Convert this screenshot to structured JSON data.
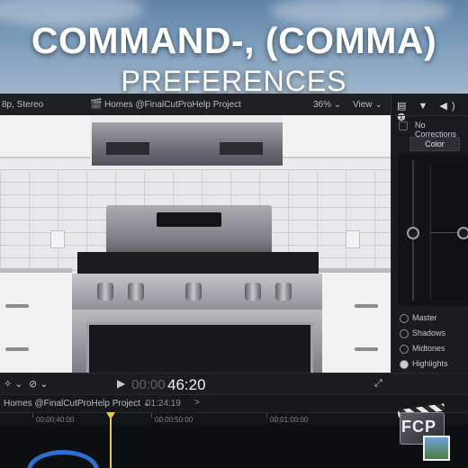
{
  "banner": {
    "title": "COMMAND-, (COMMA)",
    "subtitle": "PREFERENCES"
  },
  "viewer_bar": {
    "format": "8p, Stereo",
    "project": "Homes @FinalCutProHelp Project",
    "zoom": "36% ⌄",
    "view": "View ⌄"
  },
  "inspector": {
    "icons": "▤ ▼ ◀) ❶",
    "no_corrections": "No Corrections",
    "color_tab": "Color",
    "ranges": [
      {
        "label": "Master",
        "selected": false
      },
      {
        "label": "Shadows",
        "selected": false
      },
      {
        "label": "Midtones",
        "selected": false
      },
      {
        "label": "Highlights",
        "selected": true
      }
    ]
  },
  "controls": {
    "wand": "✧ ⌄",
    "speed": "⊘ ⌄",
    "play": "▶",
    "timecode_dim": "00:00",
    "timecode": "46:20",
    "fullscreen": "⤢"
  },
  "timeline": {
    "project": "Homes @FinalCutProHelp Project ⌄",
    "duration": "01:24:19",
    "chevron": ">",
    "ruler": [
      "00:00:40:00",
      "00:00:50:00",
      "00:01:00:00"
    ],
    "playhead_color": "#e6c84b"
  },
  "logo": {
    "text": "FCP"
  }
}
